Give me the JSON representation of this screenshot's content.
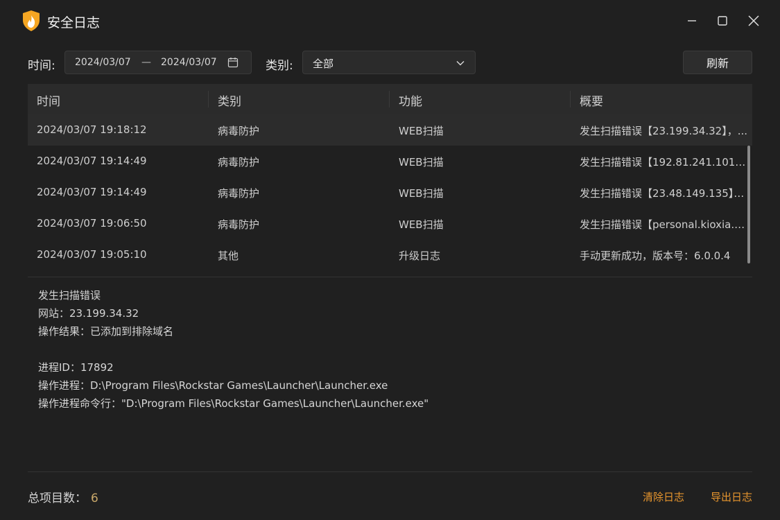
{
  "window": {
    "title": "安全日志"
  },
  "filters": {
    "time_label": "时间:",
    "date_start": "2024/03/07",
    "date_separator": "—",
    "date_end": "2024/03/07",
    "category_label": "类别:",
    "category_value": "全部",
    "refresh_label": "刷新"
  },
  "table": {
    "headers": [
      "时间",
      "类别",
      "功能",
      "概要"
    ],
    "rows": [
      {
        "time": "2024/03/07 19:18:12",
        "category": "病毒防护",
        "function": "WEB扫描",
        "summary": "发生扫描错误【23.199.34.32】，..."
      },
      {
        "time": "2024/03/07 19:14:49",
        "category": "病毒防护",
        "function": "WEB扫描",
        "summary": "发生扫描错误【192.81.241.101】..."
      },
      {
        "time": "2024/03/07 19:14:49",
        "category": "病毒防护",
        "function": "WEB扫描",
        "summary": "发生扫描错误【23.48.149.135】，..."
      },
      {
        "time": "2024/03/07 19:06:50",
        "category": "病毒防护",
        "function": "WEB扫描",
        "summary": "发生扫描错误【personal.kioxia.co..."
      },
      {
        "time": "2024/03/07 19:05:10",
        "category": "其他",
        "function": "升级日志",
        "summary": "手动更新成功，版本号：6.0.0.4"
      }
    ]
  },
  "details": {
    "lines": [
      "发生扫描错误",
      "网站：23.199.34.32",
      "操作结果：已添加到排除域名",
      "",
      "进程ID：17892",
      "操作进程：D:\\Program Files\\Rockstar Games\\Launcher\\Launcher.exe",
      "操作进程命令行：\"D:\\Program Files\\Rockstar Games\\Launcher\\Launcher.exe\""
    ]
  },
  "footer": {
    "total_label": "总项目数：",
    "total_count": "6",
    "clear_label": "清除日志",
    "export_label": "导出日志"
  },
  "colors": {
    "accent": "#e8962e",
    "background": "#202020",
    "logo": "#f5a623"
  },
  "icons": [
    "shield-flame-icon",
    "minimize-icon",
    "maximize-icon",
    "close-icon",
    "calendar-icon",
    "chevron-down-icon"
  ]
}
